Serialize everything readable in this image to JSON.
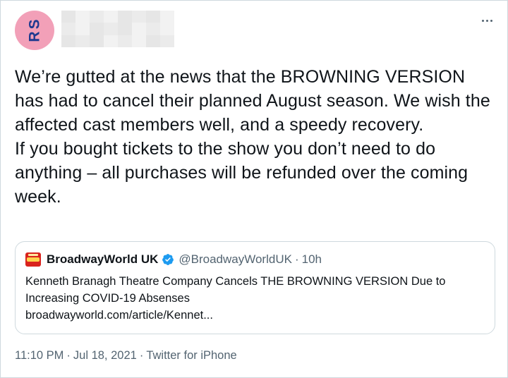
{
  "author": {
    "avatar_initials": [
      "R",
      "S"
    ],
    "avatar_color": "#f2a0b8"
  },
  "more_icon": "more-horizontal-icon",
  "tweet": {
    "paragraph1": "We’re gutted at the news that the BROWNING VERSION has had to cancel their planned August season. We wish the affected cast members well, and a speedy recovery.",
    "paragraph2": "If you bought tickets to the show you don’t need to do anything – all purchases will be refunded over the coming week."
  },
  "quoted": {
    "name": "BroadwayWorld UK",
    "verified_icon": "verified-badge-icon",
    "verified_color": "#1d9bf0",
    "handle": "@BroadwayWorldUK",
    "dot": "·",
    "time": "10h",
    "text_line1": "Kenneth Branagh Theatre Company Cancels THE BROWNING VERSION Due to",
    "text_line2": "Increasing COVID-19 Absenses",
    "link": "broadwayworld.com/article/Kennet..."
  },
  "footer": {
    "time": "11:10 PM",
    "date": "Jul 18, 2021",
    "source": "Twitter for iPhone",
    "separator": "·"
  }
}
